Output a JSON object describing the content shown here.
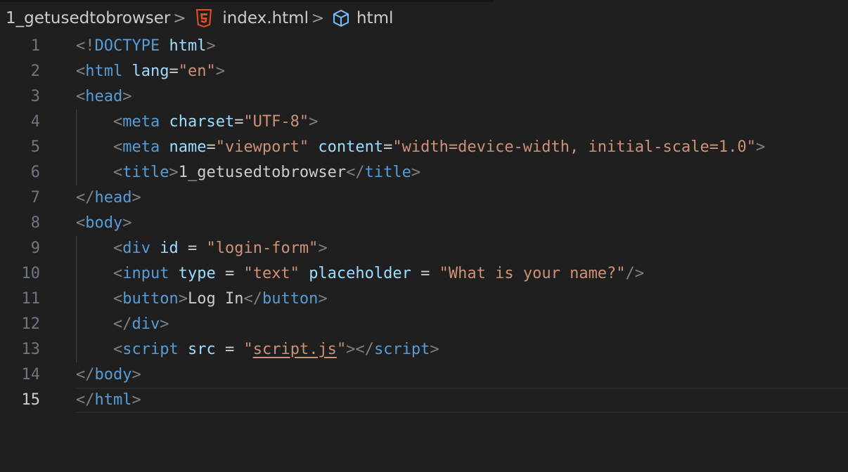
{
  "breadcrumb": {
    "folder": "1_getusedtobrowser",
    "separator": ">",
    "file": "index.html",
    "file_icon": "html5-icon",
    "symbol": "html",
    "symbol_icon": "cube-icon"
  },
  "editor": {
    "current_line": 15,
    "lines": [
      {
        "no": "1",
        "tokens": [
          {
            "c": "p",
            "t": "<!"
          },
          {
            "c": "t",
            "t": "DOCTYPE"
          },
          {
            "c": "x",
            "t": " "
          },
          {
            "c": "a",
            "t": "html"
          },
          {
            "c": "p",
            "t": ">"
          }
        ]
      },
      {
        "no": "2",
        "tokens": [
          {
            "c": "p",
            "t": "<"
          },
          {
            "c": "t",
            "t": "html"
          },
          {
            "c": "x",
            "t": " "
          },
          {
            "c": "a",
            "t": "lang"
          },
          {
            "c": "x",
            "t": "="
          },
          {
            "c": "s",
            "t": "\"en\""
          },
          {
            "c": "p",
            "t": ">"
          }
        ]
      },
      {
        "no": "3",
        "tokens": [
          {
            "c": "p",
            "t": "<"
          },
          {
            "c": "t",
            "t": "head"
          },
          {
            "c": "p",
            "t": ">"
          }
        ]
      },
      {
        "no": "4",
        "tokens": [
          {
            "c": "x",
            "t": "    "
          },
          {
            "c": "p",
            "t": "<"
          },
          {
            "c": "t",
            "t": "meta"
          },
          {
            "c": "x",
            "t": " "
          },
          {
            "c": "a",
            "t": "charset"
          },
          {
            "c": "x",
            "t": "="
          },
          {
            "c": "s",
            "t": "\"UTF-8\""
          },
          {
            "c": "p",
            "t": ">"
          }
        ]
      },
      {
        "no": "5",
        "tokens": [
          {
            "c": "x",
            "t": "    "
          },
          {
            "c": "p",
            "t": "<"
          },
          {
            "c": "t",
            "t": "meta"
          },
          {
            "c": "x",
            "t": " "
          },
          {
            "c": "a",
            "t": "name"
          },
          {
            "c": "x",
            "t": "="
          },
          {
            "c": "s",
            "t": "\"viewport\""
          },
          {
            "c": "x",
            "t": " "
          },
          {
            "c": "a",
            "t": "content"
          },
          {
            "c": "x",
            "t": "="
          },
          {
            "c": "s",
            "t": "\"width=device-width, initial-scale=1.0\""
          },
          {
            "c": "p",
            "t": ">"
          }
        ]
      },
      {
        "no": "6",
        "tokens": [
          {
            "c": "x",
            "t": "    "
          },
          {
            "c": "p",
            "t": "<"
          },
          {
            "c": "t",
            "t": "title"
          },
          {
            "c": "p",
            "t": ">"
          },
          {
            "c": "x",
            "t": "1_getusedtobrowser"
          },
          {
            "c": "p",
            "t": "</"
          },
          {
            "c": "t",
            "t": "title"
          },
          {
            "c": "p",
            "t": ">"
          }
        ]
      },
      {
        "no": "7",
        "tokens": [
          {
            "c": "p",
            "t": "</"
          },
          {
            "c": "t",
            "t": "head"
          },
          {
            "c": "p",
            "t": ">"
          }
        ]
      },
      {
        "no": "8",
        "tokens": [
          {
            "c": "p",
            "t": "<"
          },
          {
            "c": "t",
            "t": "body"
          },
          {
            "c": "p",
            "t": ">"
          }
        ]
      },
      {
        "no": "9",
        "tokens": [
          {
            "c": "x",
            "t": "    "
          },
          {
            "c": "p",
            "t": "<"
          },
          {
            "c": "t",
            "t": "div"
          },
          {
            "c": "x",
            "t": " "
          },
          {
            "c": "a",
            "t": "id"
          },
          {
            "c": "x",
            "t": " = "
          },
          {
            "c": "s",
            "t": "\"login-form\""
          },
          {
            "c": "p",
            "t": ">"
          }
        ]
      },
      {
        "no": "10",
        "tokens": [
          {
            "c": "x",
            "t": "    "
          },
          {
            "c": "p",
            "t": "<"
          },
          {
            "c": "t",
            "t": "input"
          },
          {
            "c": "x",
            "t": " "
          },
          {
            "c": "a",
            "t": "type"
          },
          {
            "c": "x",
            "t": " = "
          },
          {
            "c": "s",
            "t": "\"text\""
          },
          {
            "c": "x",
            "t": " "
          },
          {
            "c": "a",
            "t": "placeholder"
          },
          {
            "c": "x",
            "t": " = "
          },
          {
            "c": "s",
            "t": "\"What is your name?\""
          },
          {
            "c": "p",
            "t": "/>"
          }
        ]
      },
      {
        "no": "11",
        "tokens": [
          {
            "c": "x",
            "t": "    "
          },
          {
            "c": "p",
            "t": "<"
          },
          {
            "c": "t",
            "t": "button"
          },
          {
            "c": "p",
            "t": ">"
          },
          {
            "c": "x",
            "t": "Log In"
          },
          {
            "c": "p",
            "t": "</"
          },
          {
            "c": "t",
            "t": "button"
          },
          {
            "c": "p",
            "t": ">"
          }
        ]
      },
      {
        "no": "12",
        "tokens": [
          {
            "c": "x",
            "t": "    "
          },
          {
            "c": "p",
            "t": "</"
          },
          {
            "c": "t",
            "t": "div"
          },
          {
            "c": "p",
            "t": ">"
          }
        ]
      },
      {
        "no": "13",
        "tokens": [
          {
            "c": "x",
            "t": "    "
          },
          {
            "c": "p",
            "t": "<"
          },
          {
            "c": "t",
            "t": "script"
          },
          {
            "c": "x",
            "t": " "
          },
          {
            "c": "a",
            "t": "src"
          },
          {
            "c": "x",
            "t": " = "
          },
          {
            "c": "s",
            "t": "\""
          },
          {
            "c": "su",
            "t": "script.js"
          },
          {
            "c": "s",
            "t": "\""
          },
          {
            "c": "p",
            "t": "></"
          },
          {
            "c": "t",
            "t": "script"
          },
          {
            "c": "p",
            "t": ">"
          }
        ]
      },
      {
        "no": "14",
        "tokens": [
          {
            "c": "p",
            "t": "</"
          },
          {
            "c": "t",
            "t": "body"
          },
          {
            "c": "p",
            "t": ">"
          }
        ]
      },
      {
        "no": "15",
        "tokens": [
          {
            "c": "p",
            "t": "</"
          },
          {
            "c": "t",
            "t": "html"
          },
          {
            "c": "p",
            "t": ">"
          }
        ]
      }
    ]
  }
}
